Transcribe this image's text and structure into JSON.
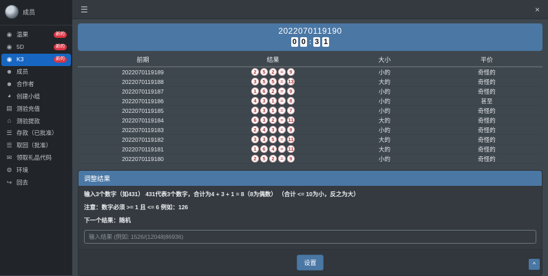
{
  "navbar": {
    "menu_icon": "☰",
    "fullscreen_icon": "×"
  },
  "sidebar": {
    "user": {
      "name": "成员"
    },
    "items": [
      {
        "label": "温果",
        "badge": "新的",
        "icon": "coins-icon"
      },
      {
        "label": "5D",
        "badge": "新的",
        "icon": "coins-icon"
      },
      {
        "label": "K3",
        "badge": "新的",
        "icon": "coins-icon",
        "active": true
      },
      {
        "label": "成员",
        "icon": "user-icon"
      },
      {
        "label": "合作者",
        "icon": "users-icon"
      },
      {
        "label": "创建小组",
        "icon": "pie-chart-icon"
      },
      {
        "label": "测验充值",
        "icon": "chart-bars-icon"
      },
      {
        "label": "测验提款",
        "icon": "bank-icon"
      },
      {
        "label": "存款（已批准）",
        "icon": "list-icon"
      },
      {
        "label": "取回（批准）",
        "icon": "list-icon"
      },
      {
        "label": "领取礼品代码",
        "icon": "gift-code-icon"
      },
      {
        "label": "环境",
        "icon": "gear-icon"
      },
      {
        "label": "回去",
        "icon": "logout-icon"
      }
    ]
  },
  "draw": {
    "period": "2022070119190",
    "countdown": [
      "0",
      "0",
      "3",
      "1"
    ]
  },
  "table": {
    "headers": [
      "前期",
      "结果",
      "大小",
      "平价"
    ],
    "rows": [
      {
        "period": "2022070119189",
        "balls": [
          "2",
          "5",
          "2",
          "=",
          "9"
        ],
        "size": "小的",
        "parity": "奇怪的"
      },
      {
        "period": "2022070119188",
        "balls": [
          "3",
          "5",
          "5",
          "=",
          "13"
        ],
        "size": "大的",
        "parity": "奇怪的"
      },
      {
        "period": "2022070119187",
        "balls": [
          "1",
          "6",
          "2",
          "=",
          "9"
        ],
        "size": "小的",
        "parity": "奇怪的"
      },
      {
        "period": "2022070119186",
        "balls": [
          "4",
          "3",
          "1",
          "=",
          "8"
        ],
        "size": "小的",
        "parity": "甚至"
      },
      {
        "period": "2022070119185",
        "balls": [
          "3",
          "3",
          "1",
          "=",
          "7"
        ],
        "size": "小的",
        "parity": "奇怪的"
      },
      {
        "period": "2022070119184",
        "balls": [
          "6",
          "3",
          "2",
          "=",
          "11"
        ],
        "size": "大的",
        "parity": "奇怪的"
      },
      {
        "period": "2022070119183",
        "balls": [
          "2",
          "4",
          "3",
          "=",
          "9"
        ],
        "size": "小的",
        "parity": "奇怪的"
      },
      {
        "period": "2022070119182",
        "balls": [
          "3",
          "3",
          "5",
          "=",
          "11"
        ],
        "size": "大的",
        "parity": "奇怪的"
      },
      {
        "period": "2022070119181",
        "balls": [
          "1",
          "6",
          "4",
          "=",
          "11"
        ],
        "size": "大的",
        "parity": "奇怪的"
      },
      {
        "period": "2022070119180",
        "balls": [
          "2",
          "5",
          "2",
          "=",
          "9"
        ],
        "size": "小的",
        "parity": "奇怪的"
      }
    ]
  },
  "adjust": {
    "title": "调整结果",
    "line1": "输入3个数字（如431） 431代表3个数字，合计为4 + 3 + 1 = 8（8为偶数） （合计 <= 10为小，反之为大）",
    "line2": "注意：数字必须 >= 1 且 <= 6 例如：126",
    "line3": "下一个结果：随机",
    "input_placeholder": "输入结果 (例如: 1526/(12048|86936)",
    "button_label": "设置"
  },
  "back_to_top": "^",
  "colors": {
    "accent_blue": "#4a77a4",
    "active_item": "#1766c1",
    "badge_red": "#dc3545",
    "ball_text": "#b23a3a"
  }
}
